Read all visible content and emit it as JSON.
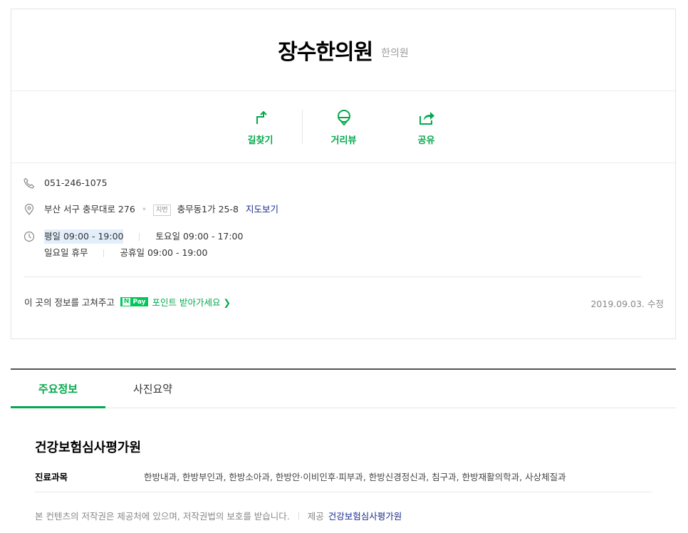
{
  "place": {
    "name": "장수한의원",
    "category": "한의원"
  },
  "actions": [
    {
      "label": "길찾기",
      "icon": "directions-icon"
    },
    {
      "label": "거리뷰",
      "icon": "street-view-icon"
    },
    {
      "label": "공유",
      "icon": "share-icon"
    }
  ],
  "info": {
    "phone": "051-246-1075",
    "address": "부산 서구 충무대로 276",
    "jibun_badge": "지번",
    "jibun_address": "충무동1가 25-8",
    "map_link": "지도보기",
    "hours": {
      "weekday": "평일 09:00 - 19:00",
      "saturday": "토요일 09:00 - 17:00",
      "sunday": "일요일 휴무",
      "holiday": "공휴일 09:00 - 19:00"
    }
  },
  "fix_prompt": {
    "text": "이 곳의 정보를 고쳐주고",
    "npay_n": "N",
    "npay_label": "Pay",
    "point_text": "포인트 받아가세요 ❯",
    "updated": "2019.09.03. 수정"
  },
  "tabs": [
    {
      "label": "주요정보",
      "active": true
    },
    {
      "label": "사진요약",
      "active": false
    }
  ],
  "section": {
    "title": "건강보험심사평가원",
    "dept_label": "진료과목",
    "dept_value": "한방내과, 한방부인과, 한방소아과, 한방안·이비인후·피부과, 한방신경정신과, 침구과, 한방재활의학과, 사상체질과",
    "copyright": "본 컨텐츠의 저작권은 제공처에 있으며, 저작권법의 보호를 받습니다.",
    "provider_label": "제공",
    "provider_name": "건강보험심사평가원"
  },
  "colors": {
    "accent": "#03a94c",
    "link": "#1a2a8c"
  }
}
